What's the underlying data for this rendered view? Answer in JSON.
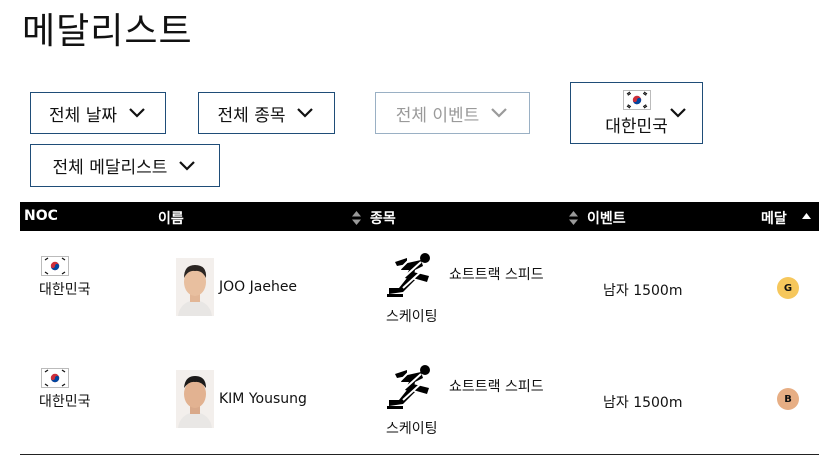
{
  "page": {
    "title": "메달리스트"
  },
  "filters": {
    "date": "전체 날짜",
    "sport": "전체 종목",
    "event": "전체 이벤트",
    "country": "대한민국",
    "medalist": "전체 메달리스트"
  },
  "table": {
    "headers": {
      "noc": "NOC",
      "name": "이름",
      "sport": "종목",
      "event": "이벤트",
      "medal": "메달"
    },
    "rows": [
      {
        "noc": "대한민국",
        "name": "JOO Jaehee",
        "sport_line1": "쇼트트랙 스피드",
        "sport_line2": "스케이팅",
        "event": "남자 1500m",
        "medal": "G",
        "medal_color": "#f6c75c"
      },
      {
        "noc": "대한민국",
        "name": "KIM Yousung",
        "sport_line1": "쇼트트랙 스피드",
        "sport_line2": "스케이팅",
        "event": "남자 1500m",
        "medal": "B",
        "medal_color": "#e7ae84"
      }
    ]
  },
  "icons": {
    "chevron": "chevron-down-icon",
    "flag": "south-korea-flag-icon",
    "sport": "short-track-skater-icon",
    "sort": "sort-icon"
  }
}
